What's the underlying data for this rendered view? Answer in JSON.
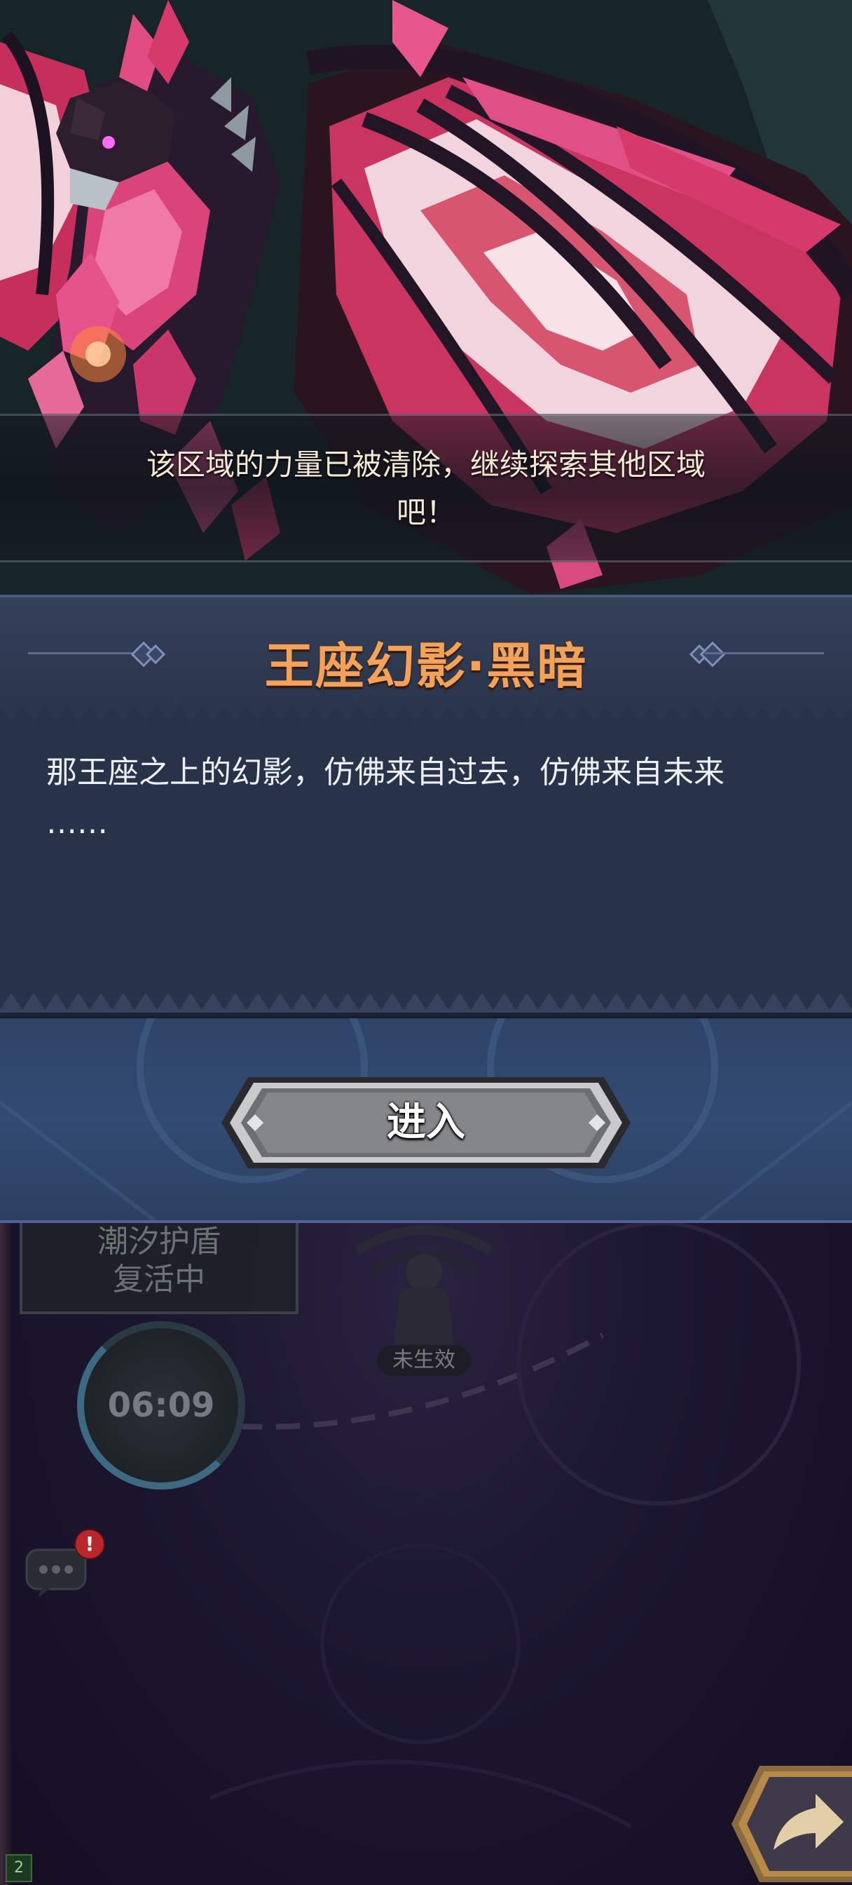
{
  "banner": {
    "message_line1": "该区域的力量已被清除，继续探索其他区域",
    "message_line2": "吧！"
  },
  "panel": {
    "title": "王座幻影·黑暗",
    "description_line1": "那王座之上的幻影，仿佛来自过去，仿佛来自未来",
    "description_line2": "……"
  },
  "enter_button": {
    "label": "进入"
  },
  "status": {
    "line1": "潮汐护盾",
    "line2": "复活中",
    "timer": "06:09"
  },
  "statue": {
    "label": "未生效"
  },
  "chat": {
    "badge": "!"
  },
  "corner_badge": "2",
  "colors": {
    "title_orange": "#f2a25a",
    "panel_bg": "#283249",
    "enter_area_bg": "#324b72",
    "dragon_pink": "#d63a6a"
  }
}
